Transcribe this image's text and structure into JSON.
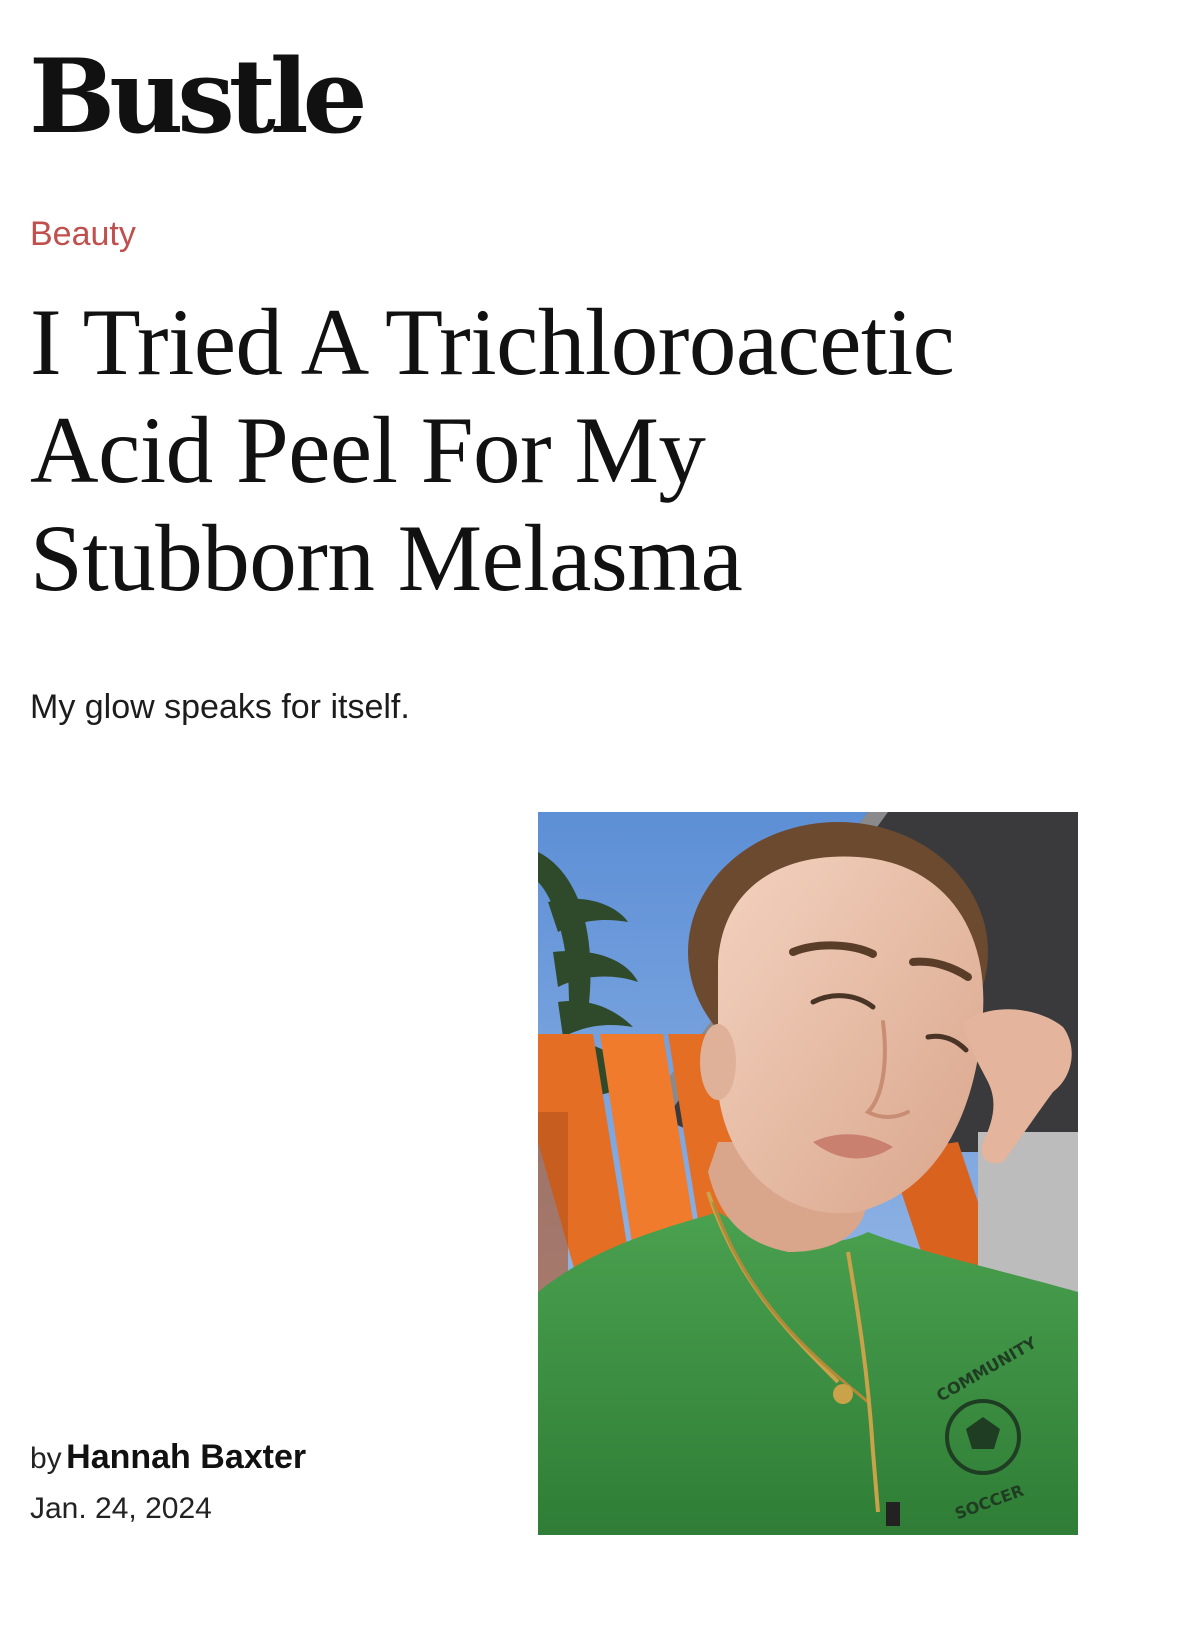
{
  "site": {
    "logo_text": "Bustle"
  },
  "article": {
    "category": "Beauty",
    "headline_lines": [
      "I Tried A Trichloroacetic",
      "Acid Peel For My",
      "Stubborn Melasma"
    ],
    "dek": "My glow speaks for itself.",
    "byline_prefix": "by",
    "author": "Hannah Baxter",
    "date": "Jan. 24, 2024"
  },
  "hero_image": {
    "shirt_text_top": "COMMUNITY",
    "shirt_text_bottom": "SOCCER"
  },
  "colors": {
    "category": "#c0504d",
    "text": "#111111",
    "shirt_green": "#3e9444",
    "chair_orange": "#e8702a",
    "sky_blue": "#6f9fd8"
  }
}
